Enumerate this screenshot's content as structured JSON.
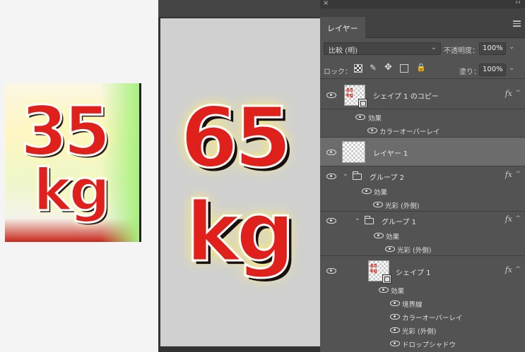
{
  "reference": {
    "number": "35",
    "unit": "kg"
  },
  "canvas": {
    "number": "65",
    "unit": "kg"
  },
  "panel": {
    "close_glyph": "×",
    "collapse_glyph": "‹‹",
    "tab_label": "レイヤー",
    "blend_mode": "比較 (明)",
    "opacity_label": "不透明度：",
    "opacity_value": "100%",
    "lock_label": "ロック：",
    "fill_label": "塗り：",
    "fill_value": "100%"
  },
  "layers": {
    "shape_copy": {
      "name": "シェイプ 1 のコピー",
      "thumb_text": "65\nkg",
      "effects_label": "効果",
      "effects": [
        "カラーオーバーレイ"
      ]
    },
    "layer1": {
      "name": "レイヤー 1"
    },
    "group2": {
      "name": "グループ 2",
      "effects_label": "効果",
      "effects": [
        "光彩 (外側)"
      ]
    },
    "group1": {
      "name": "グループ 1",
      "effects_label": "効果",
      "effects": [
        "光彩 (外側)"
      ]
    },
    "shape1": {
      "name": "シェイプ 1",
      "thumb_text": "65\nkg",
      "effects_label": "効果",
      "effects": [
        "境界線",
        "カラーオーバーレイ",
        "光彩 (外側)",
        "ドロップシャドウ"
      ]
    }
  },
  "glyphs": {
    "fx": "fx",
    "caret_up": "^",
    "chev_down": "⌄",
    "brush": "✎",
    "move": "✥",
    "lock": "🔒"
  }
}
